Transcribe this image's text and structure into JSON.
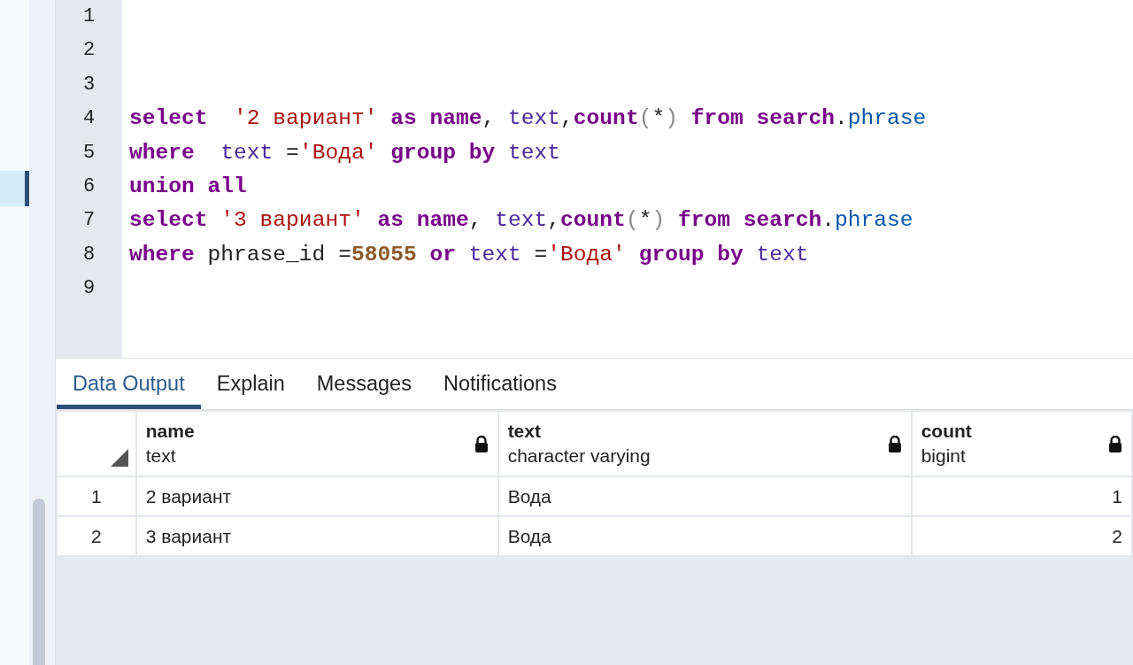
{
  "editor": {
    "lines": [
      {
        "number": "1"
      },
      {
        "number": "2"
      },
      {
        "number": "3"
      },
      {
        "number": "4",
        "tokens": [
          {
            "text": "select",
            "kind": "keyword"
          },
          {
            "text": "  '2 вариант'",
            "kind": "string"
          },
          {
            "text": " as",
            "kind": "keyword"
          },
          {
            "text": " name",
            "kind": "keyword"
          },
          {
            "text": ",",
            "kind": "plain"
          },
          {
            "text": " text",
            "kind": "builtin"
          },
          {
            "text": ",",
            "kind": "plain"
          },
          {
            "text": "count",
            "kind": "keyword"
          },
          {
            "text": "(",
            "kind": "punct"
          },
          {
            "text": "*",
            "kind": "plain"
          },
          {
            "text": ")",
            "kind": "punct"
          },
          {
            "text": " from",
            "kind": "keyword"
          },
          {
            "text": " search",
            "kind": "keyword"
          },
          {
            "text": ".",
            "kind": "plain"
          },
          {
            "text": "phrase",
            "kind": "property"
          }
        ]
      },
      {
        "number": "5",
        "tokens": [
          {
            "text": "where",
            "kind": "keyword"
          },
          {
            "text": "  text",
            "kind": "builtin"
          },
          {
            "text": " =",
            "kind": "plain"
          },
          {
            "text": "'Вода'",
            "kind": "string"
          },
          {
            "text": " group",
            "kind": "keyword"
          },
          {
            "text": " by",
            "kind": "keyword"
          },
          {
            "text": " text",
            "kind": "builtin"
          }
        ]
      },
      {
        "number": "6",
        "tokens": [
          {
            "text": "union",
            "kind": "keyword"
          },
          {
            "text": " all",
            "kind": "keyword"
          }
        ]
      },
      {
        "number": "7",
        "tokens": [
          {
            "text": "select",
            "kind": "keyword"
          },
          {
            "text": " '3 вариант'",
            "kind": "string"
          },
          {
            "text": " as",
            "kind": "keyword"
          },
          {
            "text": " name",
            "kind": "keyword"
          },
          {
            "text": ",",
            "kind": "plain"
          },
          {
            "text": " text",
            "kind": "builtin"
          },
          {
            "text": ",",
            "kind": "plain"
          },
          {
            "text": "count",
            "kind": "keyword"
          },
          {
            "text": "(",
            "kind": "punct"
          },
          {
            "text": "*",
            "kind": "plain"
          },
          {
            "text": ")",
            "kind": "punct"
          },
          {
            "text": " from",
            "kind": "keyword"
          },
          {
            "text": " search",
            "kind": "keyword"
          },
          {
            "text": ".",
            "kind": "plain"
          },
          {
            "text": "phrase",
            "kind": "property"
          }
        ]
      },
      {
        "number": "8",
        "tokens": [
          {
            "text": "where",
            "kind": "keyword"
          },
          {
            "text": " phrase_id =",
            "kind": "plain"
          },
          {
            "text": "58055",
            "kind": "number"
          },
          {
            "text": " or",
            "kind": "keyword"
          },
          {
            "text": " text",
            "kind": "builtin"
          },
          {
            "text": " =",
            "kind": "plain"
          },
          {
            "text": "'Вода'",
            "kind": "string"
          },
          {
            "text": " group",
            "kind": "keyword"
          },
          {
            "text": " by",
            "kind": "keyword"
          },
          {
            "text": " text",
            "kind": "builtin"
          }
        ]
      },
      {
        "number": "9"
      }
    ]
  },
  "output_tabs": [
    {
      "label": "Data Output",
      "selected": true
    },
    {
      "label": "Explain",
      "selected": false
    },
    {
      "label": "Messages",
      "selected": false
    },
    {
      "label": "Notifications",
      "selected": false
    }
  ],
  "table": {
    "columns": [
      {
        "name": "name",
        "type": "text",
        "kind": "text"
      },
      {
        "name": "text",
        "type": "character varying",
        "kind": "text"
      },
      {
        "name": "count",
        "type": "bigint",
        "kind": "number"
      }
    ],
    "rows": [
      {
        "number": "1",
        "cells": [
          "2 вариант",
          "Вода",
          "1"
        ]
      },
      {
        "number": "2",
        "cells": [
          "3 вариант",
          "Вода",
          "2"
        ]
      }
    ]
  }
}
